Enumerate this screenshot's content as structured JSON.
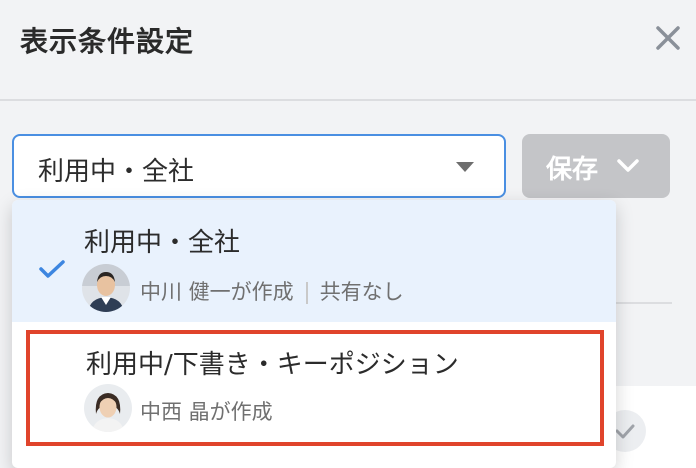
{
  "dialog": {
    "title": "表示条件設定"
  },
  "select": {
    "value": "利用中・全社"
  },
  "save_button": {
    "label": "保存"
  },
  "options": [
    {
      "label": "利用中・全社",
      "creator": "中川 健一が作成",
      "sharing": "共有なし",
      "selected": true
    },
    {
      "label": "利用中/下書き・キーポジション",
      "creator": "中西 晶が作成",
      "highlighted": true
    }
  ],
  "colors": {
    "accent": "#4a8fe2",
    "highlight_border": "#e0442b",
    "selected_bg": "#e9f2fd",
    "disabled_button": "#c4c5c8"
  },
  "icons": [
    "close-icon",
    "caret-down-icon",
    "chevron-down-icon",
    "check-icon"
  ]
}
